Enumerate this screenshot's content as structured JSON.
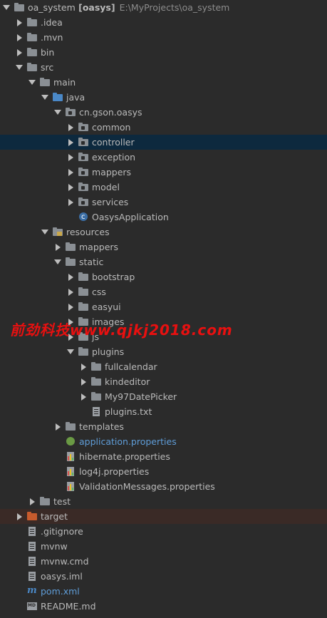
{
  "tree": [
    {
      "id": "oa_system",
      "name": "oa_system",
      "bold_suffix": "[oasys]",
      "path": "E:\\MyProjects\\oa_system",
      "depth": 0,
      "arrow": "open",
      "icon": "project-folder-icon"
    },
    {
      "id": "idea",
      "name": ".idea",
      "depth": 1,
      "arrow": "closed",
      "icon": "folder-icon"
    },
    {
      "id": "mvn",
      "name": ".mvn",
      "depth": 1,
      "arrow": "closed",
      "icon": "folder-icon"
    },
    {
      "id": "bin",
      "name": "bin",
      "depth": 1,
      "arrow": "closed",
      "icon": "folder-icon"
    },
    {
      "id": "src",
      "name": "src",
      "depth": 1,
      "arrow": "open",
      "icon": "folder-icon"
    },
    {
      "id": "main",
      "name": "main",
      "depth": 2,
      "arrow": "open",
      "icon": "folder-icon"
    },
    {
      "id": "java",
      "name": "java",
      "depth": 3,
      "arrow": "open",
      "icon": "source-folder-icon",
      "color": "blue"
    },
    {
      "id": "pkg",
      "name": "cn.gson.oasys",
      "depth": 4,
      "arrow": "open",
      "icon": "package-icon"
    },
    {
      "id": "common",
      "name": "common",
      "depth": 5,
      "arrow": "closed",
      "icon": "package-icon"
    },
    {
      "id": "controller",
      "name": "controller",
      "depth": 5,
      "arrow": "closed",
      "icon": "package-icon",
      "selected": true
    },
    {
      "id": "exception",
      "name": "exception",
      "depth": 5,
      "arrow": "closed",
      "icon": "package-icon"
    },
    {
      "id": "mappers",
      "name": "mappers",
      "depth": 5,
      "arrow": "closed",
      "icon": "package-icon"
    },
    {
      "id": "model",
      "name": "model",
      "depth": 5,
      "arrow": "closed",
      "icon": "package-icon"
    },
    {
      "id": "services",
      "name": "services",
      "depth": 5,
      "arrow": "closed",
      "icon": "package-icon"
    },
    {
      "id": "oasysapp",
      "name": "OasysApplication",
      "depth": 5,
      "arrow": "none",
      "icon": "spring-class-icon"
    },
    {
      "id": "resources",
      "name": "resources",
      "depth": 3,
      "arrow": "open",
      "icon": "resources-folder-icon"
    },
    {
      "id": "res_mappers",
      "name": "mappers",
      "depth": 4,
      "arrow": "closed",
      "icon": "folder-icon"
    },
    {
      "id": "static",
      "name": "static",
      "depth": 4,
      "arrow": "open",
      "icon": "folder-icon"
    },
    {
      "id": "bootstrap",
      "name": "bootstrap",
      "depth": 5,
      "arrow": "closed",
      "icon": "folder-icon"
    },
    {
      "id": "css",
      "name": "css",
      "depth": 5,
      "arrow": "closed",
      "icon": "folder-icon"
    },
    {
      "id": "easyui",
      "name": "easyui",
      "depth": 5,
      "arrow": "closed",
      "icon": "folder-icon"
    },
    {
      "id": "images",
      "name": "images",
      "depth": 5,
      "arrow": "closed",
      "icon": "folder-icon"
    },
    {
      "id": "js",
      "name": "js",
      "depth": 5,
      "arrow": "closed",
      "icon": "folder-icon"
    },
    {
      "id": "plugins",
      "name": "plugins",
      "depth": 5,
      "arrow": "open",
      "icon": "folder-icon"
    },
    {
      "id": "fullcalendar",
      "name": "fullcalendar",
      "depth": 6,
      "arrow": "closed",
      "icon": "folder-icon"
    },
    {
      "id": "kindeditor",
      "name": "kindeditor",
      "depth": 6,
      "arrow": "closed",
      "icon": "folder-icon"
    },
    {
      "id": "my97",
      "name": "My97DatePicker",
      "depth": 6,
      "arrow": "closed",
      "icon": "folder-icon"
    },
    {
      "id": "pluginstxt",
      "name": "plugins.txt",
      "depth": 6,
      "arrow": "none",
      "icon": "text-file-icon"
    },
    {
      "id": "templates",
      "name": "templates",
      "depth": 4,
      "arrow": "closed",
      "icon": "folder-icon"
    },
    {
      "id": "appprops",
      "name": "application.properties",
      "depth": 4,
      "arrow": "none",
      "icon": "spring-properties-icon",
      "link": true
    },
    {
      "id": "hibprops",
      "name": "hibernate.properties",
      "depth": 4,
      "arrow": "none",
      "icon": "properties-file-icon"
    },
    {
      "id": "log4j",
      "name": "log4j.properties",
      "depth": 4,
      "arrow": "none",
      "icon": "properties-file-icon"
    },
    {
      "id": "valmsg",
      "name": "ValidationMessages.properties",
      "depth": 4,
      "arrow": "none",
      "icon": "properties-file-icon"
    },
    {
      "id": "test",
      "name": "test",
      "depth": 2,
      "arrow": "closed",
      "icon": "folder-icon"
    },
    {
      "id": "target",
      "name": "target",
      "depth": 1,
      "arrow": "closed",
      "icon": "excluded-folder-icon",
      "color": "orange",
      "highlight": true
    },
    {
      "id": "gitignore",
      "name": ".gitignore",
      "depth": 1,
      "arrow": "none",
      "icon": "text-file-icon"
    },
    {
      "id": "mvnw",
      "name": "mvnw",
      "depth": 1,
      "arrow": "none",
      "icon": "text-file-icon"
    },
    {
      "id": "mvnwcmd",
      "name": "mvnw.cmd",
      "depth": 1,
      "arrow": "none",
      "icon": "text-file-icon"
    },
    {
      "id": "oasysiml",
      "name": "oasys.iml",
      "depth": 1,
      "arrow": "none",
      "icon": "iml-file-icon"
    },
    {
      "id": "pom",
      "name": "pom.xml",
      "depth": 1,
      "arrow": "none",
      "icon": "maven-icon",
      "link": true
    },
    {
      "id": "readme",
      "name": "README.md",
      "depth": 1,
      "arrow": "none",
      "icon": "markdown-file-icon"
    }
  ],
  "watermark": "前劲科技www.qjkj2018.com",
  "colors": {
    "background": "#2b2b2b",
    "selection": "#0d293e",
    "text": "#bababa",
    "link": "#5f9dd8",
    "watermark": "#e81010"
  }
}
